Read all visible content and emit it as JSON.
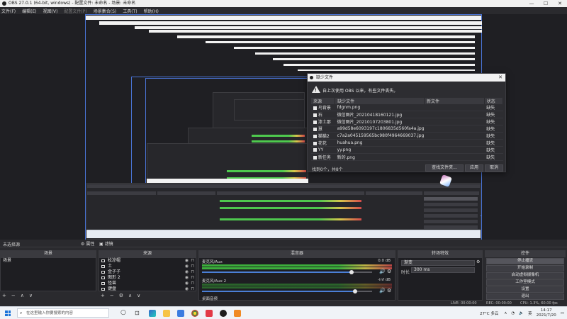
{
  "window": {
    "title": "OBS 27.0.1 (64-bit, windows) - 配置文件: 未命名 - 场景: 未命名",
    "buttons": [
      "—",
      "☐",
      "✕"
    ]
  },
  "menu": [
    {
      "label": "文件(F)",
      "enabled": true
    },
    {
      "label": "编辑(E)",
      "enabled": true
    },
    {
      "label": "视图(V)",
      "enabled": true
    },
    {
      "label": "配置文件(P)",
      "enabled": false
    },
    {
      "label": "场景集合(S)",
      "enabled": true
    },
    {
      "label": "工具(T)",
      "enabled": true
    },
    {
      "label": "帮助(H)",
      "enabled": true
    }
  ],
  "dialog": {
    "title": "缺少文件",
    "warning": "自上次使用 OBS 以来，有些文件丢失。",
    "columns": [
      "来源",
      "缺少文件",
      "新文件",
      "状态"
    ],
    "rows": [
      {
        "source": "鸟背景",
        "missing": "fdgnm.png",
        "new": "",
        "status": "缺失"
      },
      {
        "source": "石",
        "missing": "微信图片_20210418160121.jpg",
        "new": "",
        "status": "缺失"
      },
      {
        "source": "漆土那",
        "missing": "微信图片_20210107203801.jpg",
        "new": "",
        "status": "缺失"
      },
      {
        "source": "慧",
        "missing": "a99d58e6093197c1806835d560fa4a.jpg",
        "new": "",
        "status": "缺失"
      },
      {
        "source": "猫猫2",
        "missing": "c7a2a045159565bc980f4964669037.jpg",
        "new": "",
        "status": "缺失"
      },
      {
        "source": "花花",
        "missing": "huahua.png",
        "new": "",
        "status": "缺失"
      },
      {
        "source": "YY",
        "missing": "yy.png",
        "new": "",
        "status": "缺失"
      },
      {
        "source": "新任务",
        "missing": "新的.png",
        "new": "",
        "status": "缺失"
      }
    ],
    "found_text": "找到0个，共8个",
    "search_button": "查找文件夹...",
    "apply_button": "应用",
    "cancel_button": "取消"
  },
  "panels": {
    "scene_filter": "未选择源",
    "filter_button": "属性",
    "filter_button2": "滤镜",
    "scenes_header": "场景",
    "scenes": [
      "场景"
    ],
    "sources_header": "来源",
    "sources": [
      {
        "name": "松凉帽",
        "icon": "image-icon"
      },
      {
        "name": "土",
        "icon": "image-icon"
      },
      {
        "name": "金子子",
        "icon": "image-icon"
      },
      {
        "name": "图形 2",
        "icon": "image-icon"
      },
      {
        "name": "怪兽",
        "icon": "image-icon"
      },
      {
        "name": "键盘",
        "icon": "image-icon"
      }
    ],
    "mixer_header": "混音器",
    "mixer": [
      {
        "name": "麦克风/Aux",
        "db": "0.0 dB",
        "level": 0.9,
        "volume": 0.88
      },
      {
        "name": "麦克风/Aux 2",
        "db": "-inf dB",
        "level": 0.0,
        "volume": 0.9
      }
    ],
    "mixer_extra": "桌面音频",
    "transitions_header": "转场特效",
    "transition_type": "渐变",
    "duration_label": "时长",
    "duration_value": "300 ms",
    "controls_header": "控件",
    "controls": [
      "停止播流",
      "开始录制",
      "启动虚拟摄像机",
      "工作室模式",
      "设置",
      "退出"
    ],
    "toolbar_add": "+",
    "toolbar_remove": "−",
    "toolbar_up": "∧",
    "toolbar_down": "∨",
    "toolbar_settings": "⚙"
  },
  "status": {
    "live": "LIVE: 00:00:00",
    "rec": "REC: 00:00:00",
    "cpu": "CPU: 1.3%, 60.00 fps"
  },
  "taskbar": {
    "search_placeholder": "在这里输入你要搜索的内容",
    "weather": "27°C 多云",
    "time": "14:17",
    "date": "2021/7/20",
    "lang": "英"
  }
}
